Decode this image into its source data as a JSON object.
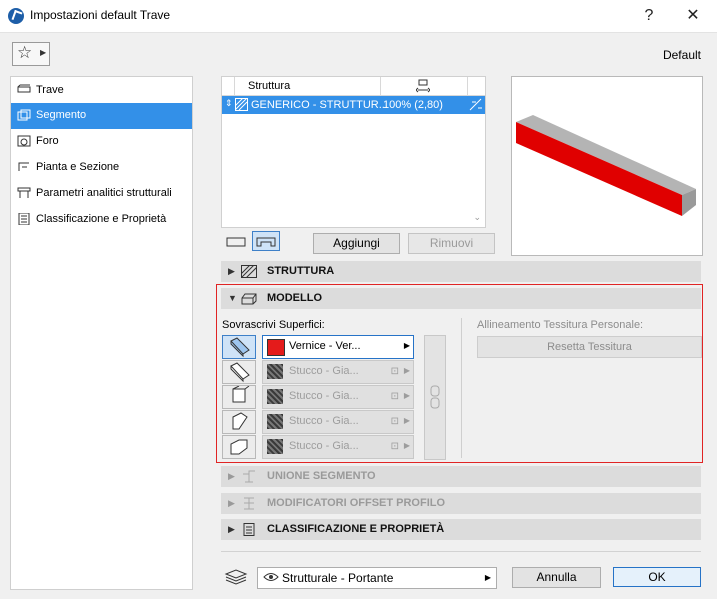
{
  "window": {
    "title": "Impostazioni default Trave",
    "help_label": "?",
    "close_label": "✕"
  },
  "header": {
    "default_label": "Default",
    "favorites_icon": "star-icon"
  },
  "sidebar": {
    "items": [
      {
        "label": "Trave",
        "icon": "beam-icon"
      },
      {
        "label": "Segmento",
        "icon": "segment-icon",
        "selected": true
      },
      {
        "label": "Foro",
        "icon": "hole-icon"
      },
      {
        "label": "Pianta e Sezione",
        "icon": "floorplan-icon"
      },
      {
        "label": "Parametri analitici strutturali",
        "icon": "structural-icon"
      },
      {
        "label": "Classificazione e Proprietà",
        "icon": "properties-icon"
      }
    ]
  },
  "segment_table": {
    "columns": [
      "Struttura",
      ""
    ],
    "rows": [
      {
        "name": "GENERICO - STRUTTUR...",
        "value": "100% (2,80)"
      }
    ]
  },
  "buttons": {
    "add": "Aggiungi",
    "remove": "Rimuovi",
    "cancel": "Annulla",
    "ok": "OK"
  },
  "panels": {
    "struttura": "STRUTTURA",
    "modello": "MODELLO",
    "unione": "UNIONE SEGMENTO",
    "modificatori": "MODIFICATORI OFFSET PROFILO",
    "classificazione": "CLASSIFICAZIONE E PROPRIETÀ"
  },
  "modello": {
    "override_label": "Sovrascrivi Superfici:",
    "alignment_label": "Allineamento Tessitura Personale:",
    "reset_label": "Resetta Tessitura",
    "surfaces": [
      {
        "name": "Vernice - Ver...",
        "color": "#e41b1b",
        "active": true
      },
      {
        "name": "Stucco - Gia...",
        "color": "#5a5a5a",
        "active": false
      },
      {
        "name": "Stucco - Gia...",
        "color": "#5a5a5a",
        "active": false
      },
      {
        "name": "Stucco - Gia...",
        "color": "#5a5a5a",
        "active": false
      },
      {
        "name": "Stucco - Gia...",
        "color": "#5a5a5a",
        "active": false
      }
    ]
  },
  "footer": {
    "layer_value": "Strutturale - Portante"
  },
  "colors": {
    "accent": "#3390e8",
    "frame": "#e02424",
    "beam": "#e00000"
  }
}
